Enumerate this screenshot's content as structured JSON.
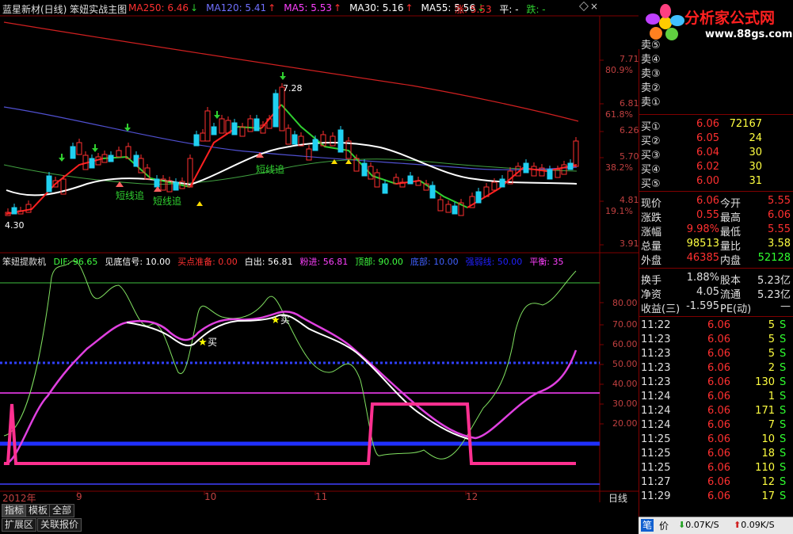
{
  "main": {
    "title": "蓝星新材(日线) 笨妞实战主图",
    "ma": [
      {
        "label": "MA250: 6.46",
        "color": "#ff3030",
        "arrow": "↓"
      },
      {
        "label": "MA120: 5.41",
        "color": "#7070ff",
        "arrow": "↑"
      },
      {
        "label": "MA5: 5.53",
        "color": "#ff40ff",
        "arrow": "↑"
      },
      {
        "label": "MA30: 5.16",
        "color": "#ffffff",
        "arrow": "↑"
      },
      {
        "label": "MA55: 5.56",
        "color": "#ffffff",
        "arrow": "↓"
      }
    ],
    "zhang": "涨: 5.53",
    "ping": "平: -",
    "die": "跌: -",
    "price_axis": [
      "7.71",
      "80.9%",
      "6.81",
      "61.8%",
      "6.26",
      "5.70",
      "38.2%",
      "4.81",
      "19.1%",
      "3.91"
    ],
    "annotations": {
      "high": "7.28",
      "low": "4.30",
      "short1": "短线追",
      "short2": "短线追",
      "short3": "短线追"
    }
  },
  "indicator": {
    "name": "笨妞提款机",
    "items": [
      {
        "label": "DIF: 96.65",
        "color": "#40ff40"
      },
      {
        "label": "见底信号: 10.00",
        "color": "#ffffff"
      },
      {
        "label": "买点准备: 0.00",
        "color": "#ff3030"
      },
      {
        "label": "白出: 56.81",
        "color": "#ffffff"
      },
      {
        "label": "粉进: 56.81",
        "color": "#ff40ff"
      },
      {
        "label": "顶部: 90.00",
        "color": "#40ff40"
      },
      {
        "label": "底部: 10.00",
        "color": "#4060ff"
      },
      {
        "label": "强弱线: 50.00",
        "color": "#2020ff"
      },
      {
        "label": "平衡: 35",
        "color": "#ff40ff"
      }
    ],
    "axis": [
      "80.00",
      "70.00",
      "60.00",
      "50.00",
      "40.00",
      "30.00",
      "20.00"
    ],
    "buy1": "买",
    "buy2": "买"
  },
  "time_axis": {
    "year": "2012年",
    "m9": "9",
    "m10": "10",
    "m11": "11",
    "m12": "12",
    "period": "日线"
  },
  "tabs": [
    "指标",
    "模板",
    "全部"
  ],
  "tabs2": [
    "扩展区",
    "关联报价"
  ],
  "logo": {
    "title": "分析家公式网",
    "url": "www.88gs.com"
  },
  "sell_orders": [
    {
      "label": "卖⑤",
      "price": "",
      "vol": ""
    },
    {
      "label": "卖④",
      "price": "",
      "vol": ""
    },
    {
      "label": "卖③",
      "price": "",
      "vol": ""
    },
    {
      "label": "卖②",
      "price": "",
      "vol": ""
    },
    {
      "label": "卖①",
      "price": "",
      "vol": ""
    }
  ],
  "buy_orders": [
    {
      "label": "买①",
      "price": "6.06",
      "vol": "72167"
    },
    {
      "label": "买②",
      "price": "6.05",
      "vol": "24"
    },
    {
      "label": "买③",
      "price": "6.04",
      "vol": "30"
    },
    {
      "label": "买④",
      "price": "6.02",
      "vol": "30"
    },
    {
      "label": "买⑤",
      "price": "6.00",
      "vol": "31"
    }
  ],
  "quote": [
    {
      "l1": "现价",
      "v1": "6.06",
      "l2": "今开",
      "v2": "5.55"
    },
    {
      "l1": "涨跌",
      "v1": "0.55",
      "l2": "最高",
      "v2": "6.06"
    },
    {
      "l1": "涨幅",
      "v1": "9.98%",
      "l2": "最低",
      "v2": "5.55"
    },
    {
      "l1": "总量",
      "v1": "98513",
      "l2": "量比",
      "v2": "3.58"
    },
    {
      "l1": "外盘",
      "v1": "46385",
      "l2": "内盘",
      "v2": "52128"
    }
  ],
  "fund": [
    {
      "l1": "换手",
      "v1": "1.88%",
      "l2": "股本",
      "v2": "5.23亿"
    },
    {
      "l1": "净资",
      "v1": "4.05",
      "l2": "流通",
      "v2": "5.23亿"
    },
    {
      "l1": "收益(三)",
      "v1": "-1.595",
      "l2": "PE(动)",
      "v2": "—"
    }
  ],
  "ticks": [
    {
      "t": "11:22",
      "p": "6.06",
      "v": "5",
      "s": "S"
    },
    {
      "t": "11:23",
      "p": "6.06",
      "v": "5",
      "s": "S"
    },
    {
      "t": "11:23",
      "p": "6.06",
      "v": "5",
      "s": "S"
    },
    {
      "t": "11:23",
      "p": "6.06",
      "v": "2",
      "s": "S"
    },
    {
      "t": "11:23",
      "p": "6.06",
      "v": "130",
      "s": "S"
    },
    {
      "t": "11:24",
      "p": "6.06",
      "v": "1",
      "s": "S"
    },
    {
      "t": "11:24",
      "p": "6.06",
      "v": "171",
      "s": "S"
    },
    {
      "t": "11:24",
      "p": "6.06",
      "v": "7",
      "s": "S"
    },
    {
      "t": "11:25",
      "p": "6.06",
      "v": "10",
      "s": "S"
    },
    {
      "t": "11:25",
      "p": "6.06",
      "v": "18",
      "s": "S"
    },
    {
      "t": "11:25",
      "p": "6.06",
      "v": "110",
      "s": "S"
    },
    {
      "t": "11:27",
      "p": "6.06",
      "v": "12",
      "s": "S"
    },
    {
      "t": "11:29",
      "p": "6.06",
      "v": "17",
      "s": "S"
    }
  ],
  "status": {
    "bi": "笔",
    "jia": "价",
    "down": "0.07K/S",
    "up": "0.09K/S"
  }
}
